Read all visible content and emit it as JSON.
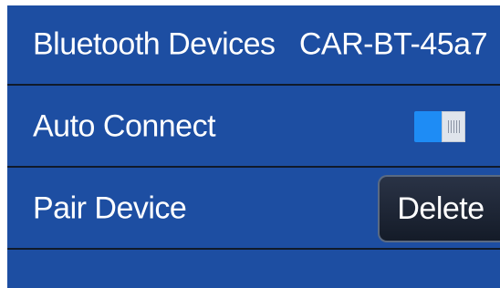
{
  "settings": {
    "bluetooth_devices": {
      "label": "Bluetooth Devices",
      "value": "CAR-BT-45a7"
    },
    "auto_connect": {
      "label": "Auto Connect",
      "enabled": true
    },
    "pair_device": {
      "label": "Pair Device",
      "delete_label": "Delete"
    }
  },
  "colors": {
    "background": "#1d4ea2",
    "toggle_on": "#1e8cf5",
    "divider": "#101a2a",
    "button": "#1a2232"
  }
}
